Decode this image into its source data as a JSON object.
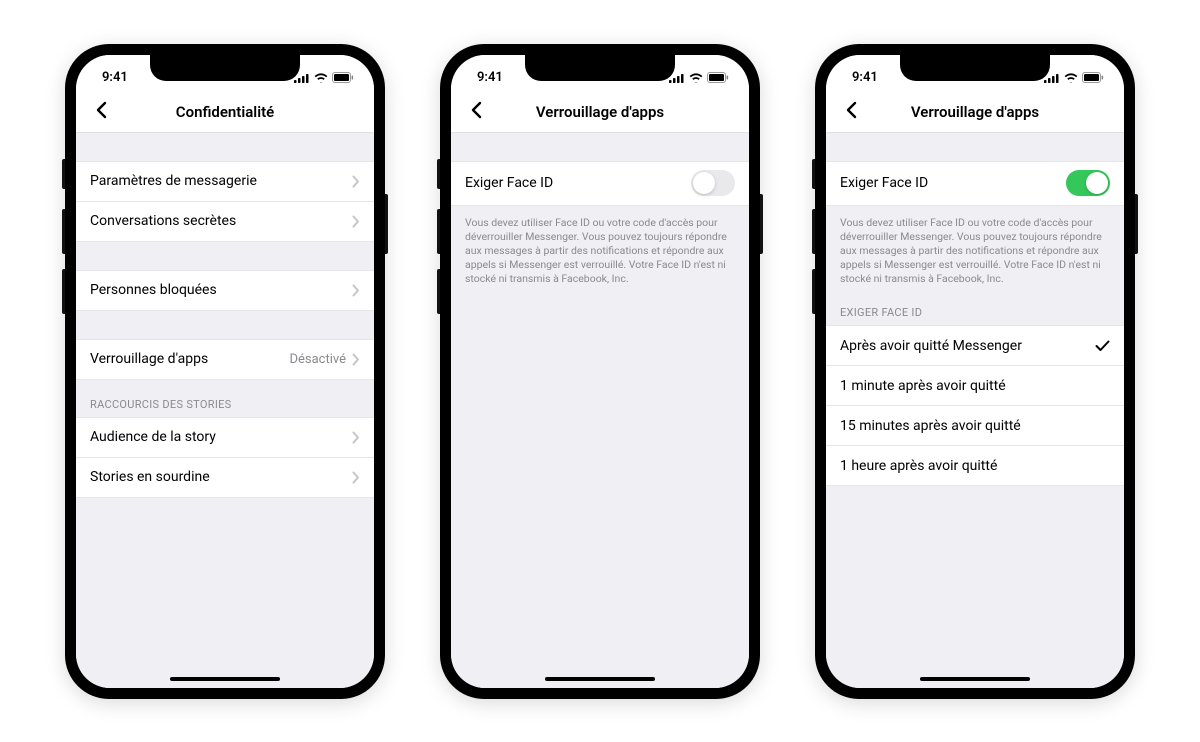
{
  "status": {
    "time": "9:41"
  },
  "phone1": {
    "title": "Confidentialité",
    "rows": {
      "messaging": "Paramètres de messagerie",
      "secret": "Conversations secrètes",
      "blocked": "Personnes bloquées",
      "applock": "Verrouillage d'apps",
      "applock_status": "Désactivé",
      "section_stories": "RACCOURCIS DES STORIES",
      "audience": "Audience de la story",
      "muted": "Stories en sourdine"
    }
  },
  "phone2": {
    "title": "Verrouillage d'apps",
    "faceid_label": "Exiger Face ID",
    "footer": "Vous devez utiliser Face ID ou votre code d'accès pour déverrouiller Messenger. Vous pouvez toujours répondre aux messages à partir des notifications et répondre aux appels si Messenger est verrouillé. Votre Face ID n'est ni stocké ni transmis à Facebook, Inc."
  },
  "phone3": {
    "title": "Verrouillage d'apps",
    "faceid_label": "Exiger Face ID",
    "footer": "Vous devez utiliser Face ID ou votre code d'accès pour déverrouiller Messenger. Vous pouvez toujours répondre aux messages à partir des notifications et répondre aux appels si Messenger est verrouillé. Votre Face ID n'est ni stocké ni transmis à Facebook, Inc.",
    "section_exiger": "EXIGER FACE ID",
    "options": {
      "o1": "Après avoir quitté Messenger",
      "o2": "1 minute après avoir quitté",
      "o3": "15 minutes après avoir quitté",
      "o4": "1 heure après avoir quitté"
    }
  }
}
